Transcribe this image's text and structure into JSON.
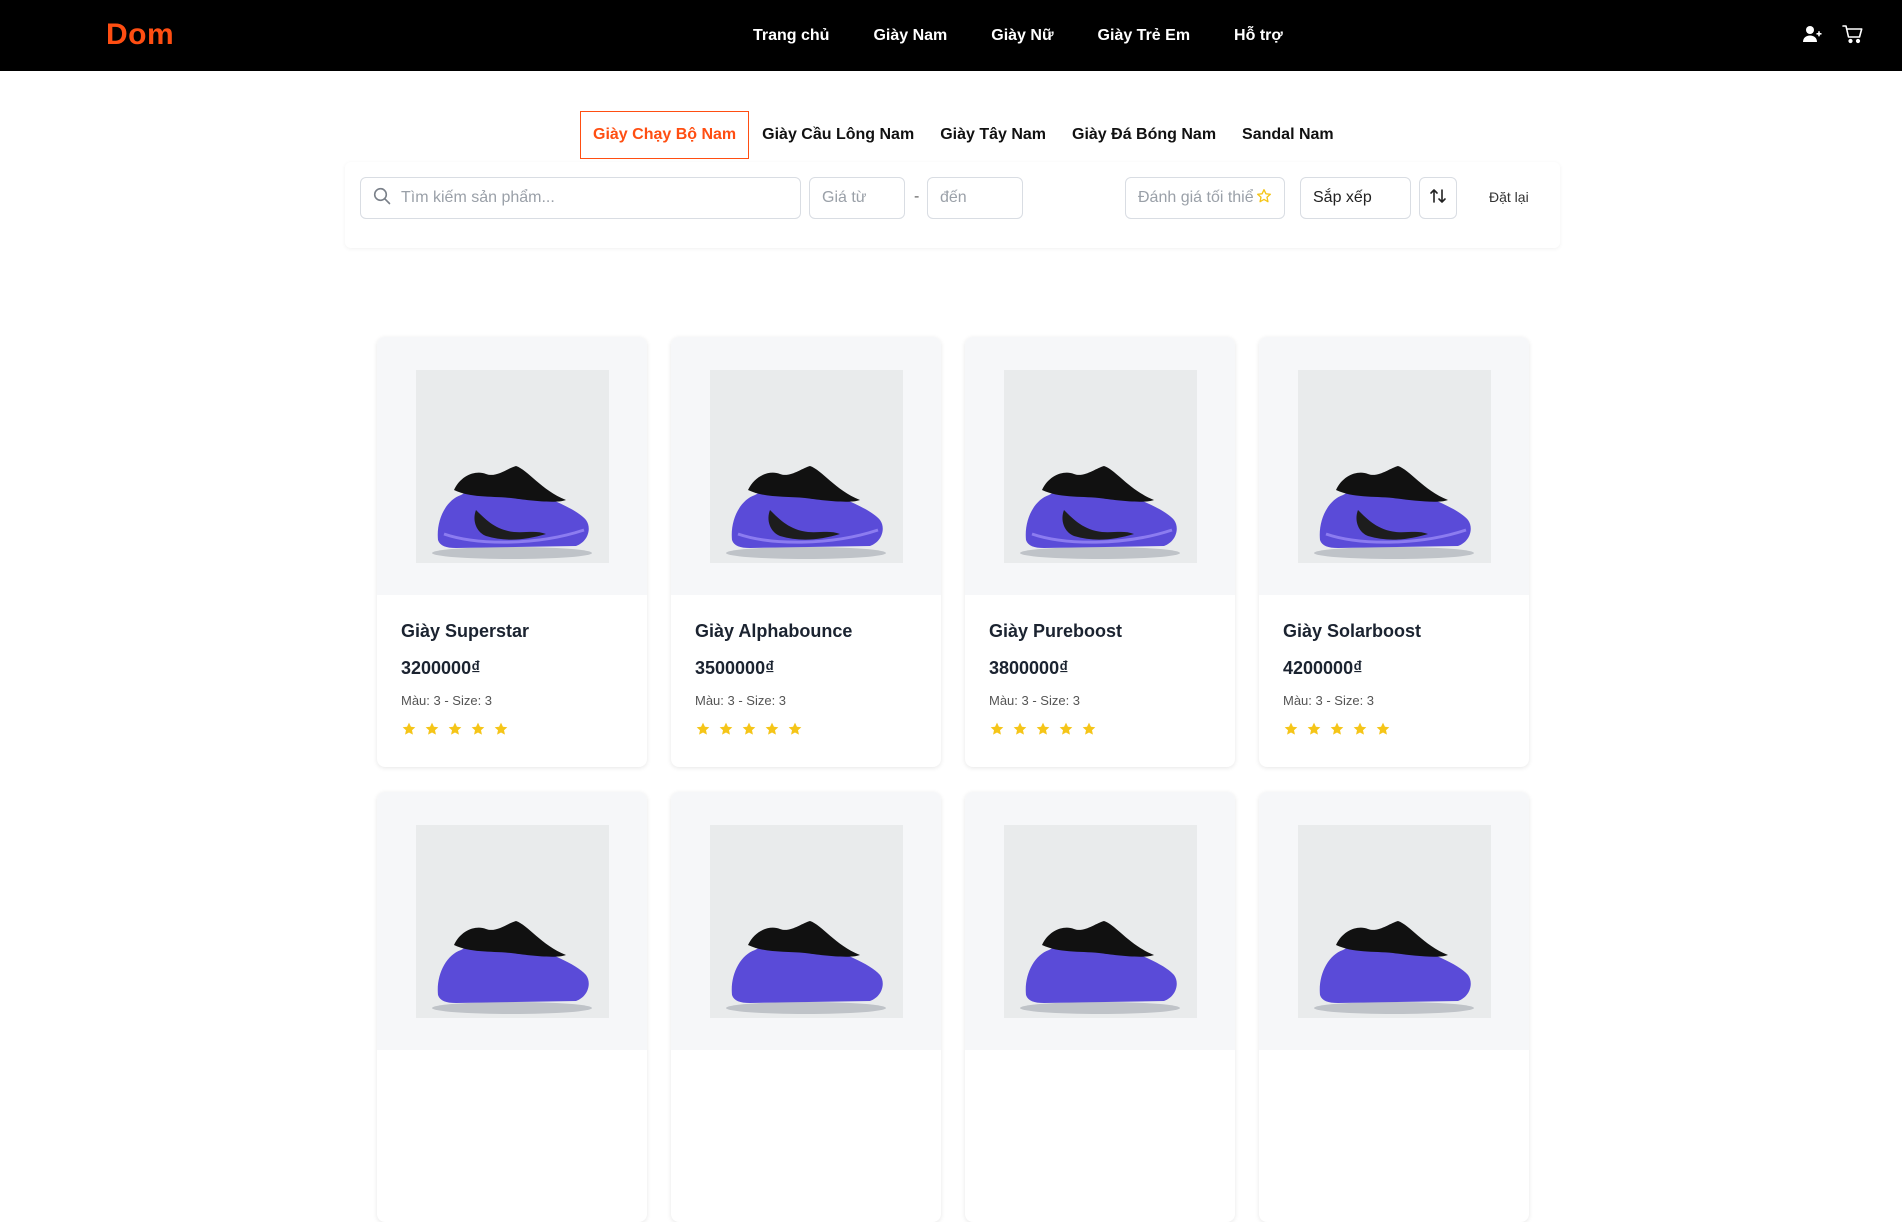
{
  "brand": {
    "logo": "Dom",
    "accent": "#ff4e12"
  },
  "nav": {
    "items": [
      {
        "label": "Trang chủ"
      },
      {
        "label": "Giày Nam"
      },
      {
        "label": "Giày Nữ"
      },
      {
        "label": "Giày Trẻ Em"
      },
      {
        "label": "Hỗ trợ"
      }
    ],
    "icons": [
      "user-add-icon",
      "cart-icon"
    ]
  },
  "categories": {
    "tabs": [
      {
        "label": "Giày Chạy Bộ Nam",
        "active": true
      },
      {
        "label": "Giày Cầu Lông Nam",
        "active": false
      },
      {
        "label": "Giày Tây Nam",
        "active": false
      },
      {
        "label": "Giày Đá Bóng Nam",
        "active": false
      },
      {
        "label": "Sandal Nam",
        "active": false
      }
    ]
  },
  "filters": {
    "search_placeholder": "Tìm kiếm sản phẩm...",
    "price_from_placeholder": "Giá từ",
    "price_separator": "-",
    "price_to_placeholder": "đến",
    "rating_placeholder": "Đánh giá tối thiể",
    "sort_label": "Sắp xếp",
    "reset_label": "Đặt lại"
  },
  "products": [
    {
      "name": "Giày Superstar",
      "price": "3200000₫",
      "meta": "Màu: 3 - Size: 3",
      "rating": 5
    },
    {
      "name": "Giày Alphabounce",
      "price": "3500000₫",
      "meta": "Màu: 3 - Size: 3",
      "rating": 5
    },
    {
      "name": "Giày Pureboost",
      "price": "3800000₫",
      "meta": "Màu: 3 - Size: 3",
      "rating": 5
    },
    {
      "name": "Giày Solarboost",
      "price": "4200000₫",
      "meta": "Màu: 3 - Size: 3",
      "rating": 5
    },
    {
      "name": "",
      "price": "",
      "meta": "",
      "rating": 0
    },
    {
      "name": "",
      "price": "",
      "meta": "",
      "rating": 0
    },
    {
      "name": "",
      "price": "",
      "meta": "",
      "rating": 0
    },
    {
      "name": "",
      "price": "",
      "meta": "",
      "rating": 0
    }
  ]
}
